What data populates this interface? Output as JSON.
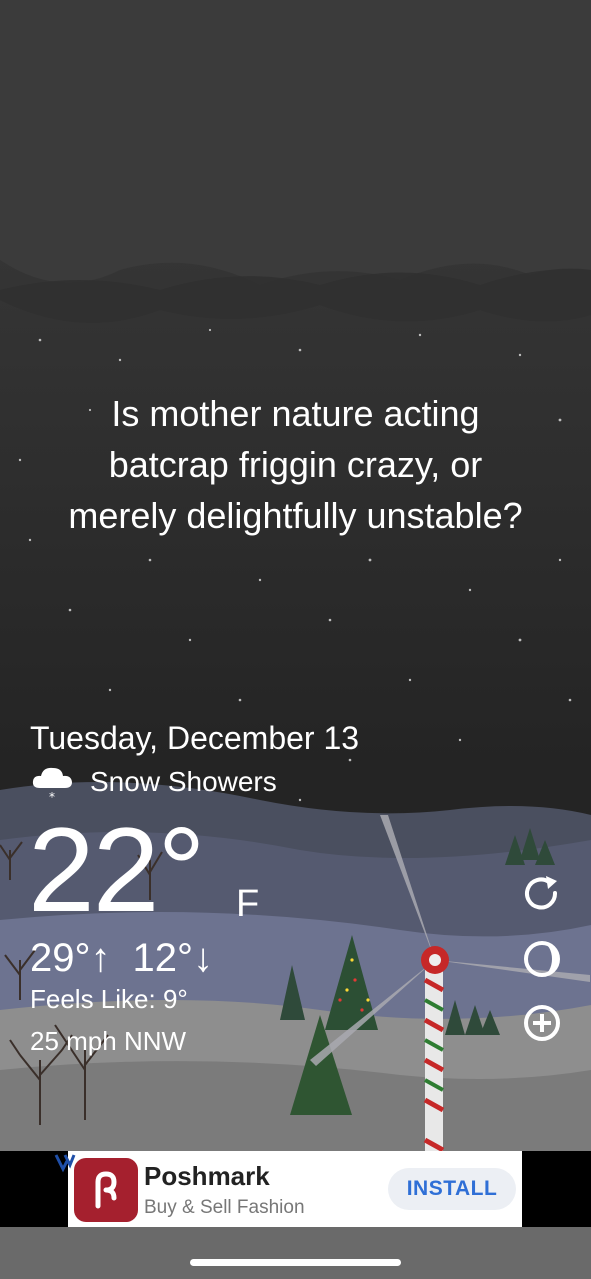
{
  "quote": {
    "line1": "Is mother nature acting",
    "line2": "batcrap friggin crazy, or",
    "line3": "merely delightfully unstable?"
  },
  "weather": {
    "date": "Tuesday, December 13",
    "condition": "Snow Showers",
    "condition_icon": "snow-cloud-icon",
    "temperature": "22°",
    "unit": "F",
    "high": "29°↑",
    "low": "12°↓",
    "feels_like": "Feels Like: 9°",
    "wind": "25 mph NNW"
  },
  "side_buttons": [
    "refresh-icon",
    "theme-icon",
    "add-icon"
  ],
  "ad": {
    "title": "Poshmark",
    "subtitle": "Buy & Sell Fashion",
    "cta": "INSTALL",
    "brand_color": "#a5202e",
    "cta_color": "#2f6fd6"
  }
}
